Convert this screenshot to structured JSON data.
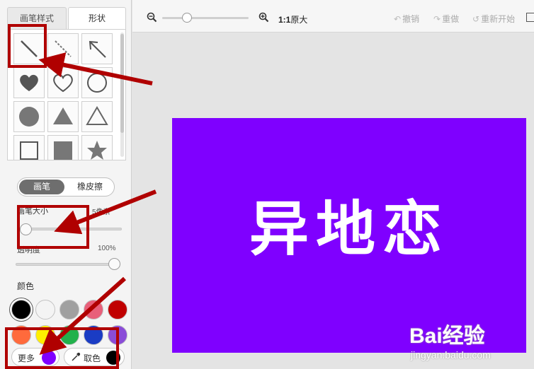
{
  "tabs": [
    {
      "label": "画笔样式"
    },
    {
      "label": "形状"
    }
  ],
  "shapes": [
    {
      "name": "line"
    },
    {
      "name": "dashed-line"
    },
    {
      "name": "arrow"
    },
    {
      "name": "heart-filled"
    },
    {
      "name": "heart-outline"
    },
    {
      "name": "circle-outline"
    },
    {
      "name": "circle-filled"
    },
    {
      "name": "triangle-filled"
    },
    {
      "name": "triangle-outline"
    },
    {
      "name": "square-outline"
    },
    {
      "name": "square-filled"
    },
    {
      "name": "star-filled"
    }
  ],
  "mode": {
    "brush_label": "画笔",
    "eraser_label": "橡皮擦",
    "active": "brush"
  },
  "brush_size": {
    "label": "画笔大小",
    "value_text": "5像素",
    "level": 0.05
  },
  "opacity": {
    "label": "透明度",
    "value_text": "100%",
    "level": 1.0
  },
  "colors": {
    "label": "颜色",
    "swatches": [
      "#000000",
      "#f4f4f4",
      "#a0a0a0",
      "#e8607a",
      "#c00000",
      "#ff6a3c",
      "#ffee00",
      "#22b14c",
      "#1a3cc4",
      "#8a4cd8"
    ],
    "selected": "#000000",
    "more_label": "更多",
    "more_color": "#7f00ff",
    "pick_label": "取色",
    "pick_color": "#000000"
  },
  "toolbar": {
    "zoom_ratio": "1:1",
    "zoom_suffix": "原大",
    "undo_label": "撤销",
    "redo_label": "重做",
    "restart_label": "重新开始"
  },
  "canvas": {
    "background": "#7f00ff",
    "text": "异地恋",
    "text_color": "#ffffff"
  },
  "watermark": {
    "brand": "Bai经验",
    "url": "jingyan.baidu.com"
  },
  "annotation_color": "#b00000"
}
